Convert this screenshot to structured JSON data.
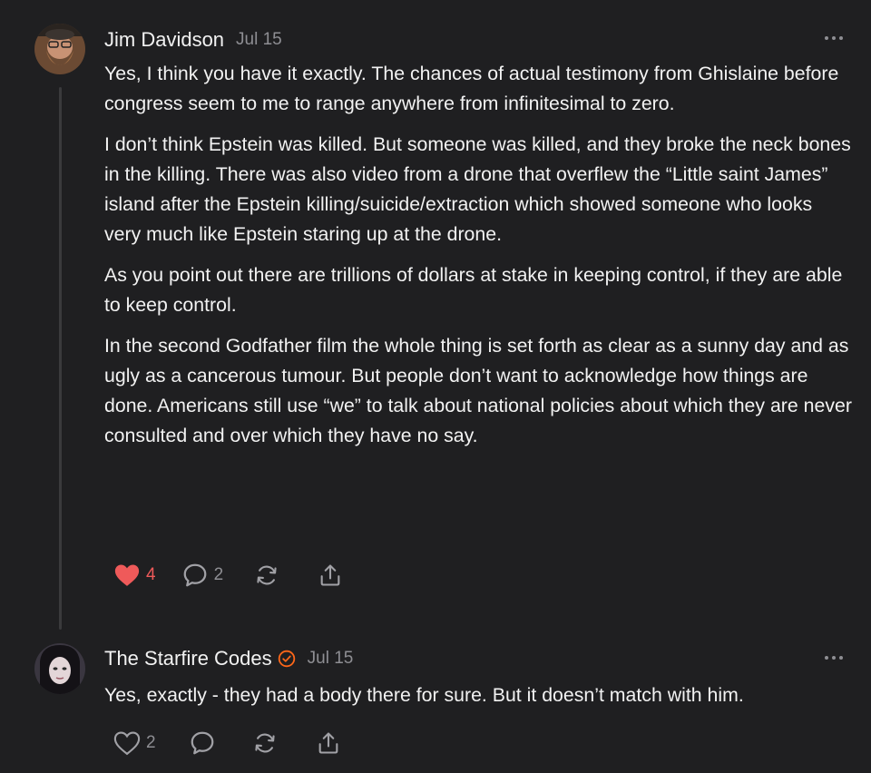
{
  "comments": [
    {
      "author": "Jim Davidson",
      "date": "Jul 15",
      "verified": false,
      "liked": true,
      "paragraphs": [
        "Yes, I think you have it exactly. The chances of actual testimony from Ghislaine before congress seem to me to range anywhere from infinitesimal to zero.",
        "I don’t think Epstein was killed. But someone was killed, and they broke the neck bones in the killing. There was also video from a drone that overflew the “Little saint James” island after the Epstein killing/suicide/extraction which showed someone who looks very much like Epstein staring up at the drone.",
        "As you point out there are trillions of dollars at stake in keeping control, if they are able to keep control.",
        "In the second Godfather film the whole thing is set forth as clear as a sunny day and as ugly as a cancerous tumour. But people don’t want to acknowledge how things are done. Americans still use “we” to talk about national policies about which they are never consulted and over which they have no say."
      ],
      "likes": "4",
      "replies": "2"
    },
    {
      "author": "The Starfire Codes",
      "date": "Jul 15",
      "verified": true,
      "liked": false,
      "paragraphs": [
        "Yes, exactly - they had a body there for sure. But it doesn’t match with him."
      ],
      "likes": "2",
      "replies": ""
    }
  ],
  "icons": [
    "heart-icon",
    "comment-icon",
    "restack-icon",
    "share-icon",
    "more-icon",
    "verified-icon"
  ],
  "colors": {
    "background": "#1f1f21",
    "text": "#f2f2f2",
    "muted": "#8e8e93",
    "liked": "#ef5a5a",
    "verified": "#ff6719"
  }
}
